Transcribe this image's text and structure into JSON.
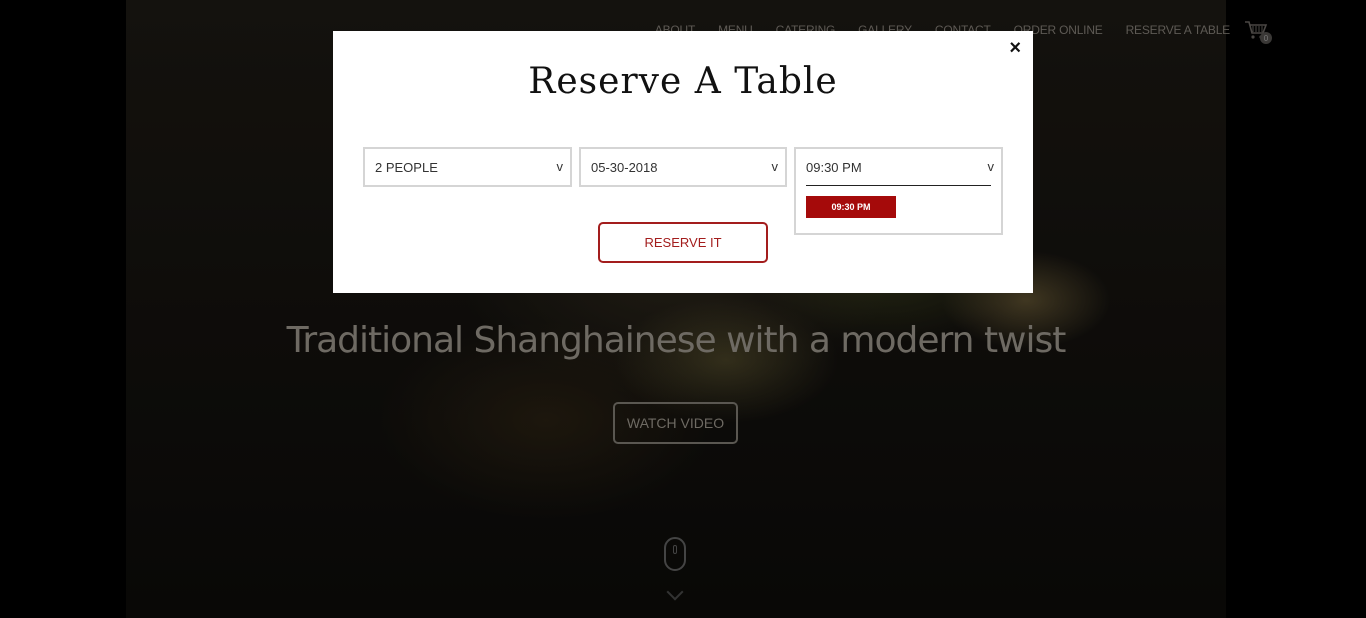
{
  "nav": {
    "items": [
      "ABOUT",
      "MENU",
      "CATERING",
      "GALLERY",
      "CONTACT",
      "ORDER ONLINE",
      "RESERVE A TABLE"
    ],
    "cart_count": "0"
  },
  "hero": {
    "tagline": "Traditional Shanghainese with a modern twist",
    "watch_video_label": "WATCH VIDEO"
  },
  "modal": {
    "title": "Reserve A Table",
    "close_label": "×",
    "people_value": "2 PEOPLE",
    "date_value": "05-30-2018",
    "time_value": "09:30 PM",
    "time_option": "09:30 PM",
    "dropdown_caret": "v",
    "reserve_label": "RESERVE IT"
  },
  "colors": {
    "accent": "#a50a0a",
    "button_border": "#a31d1d"
  }
}
